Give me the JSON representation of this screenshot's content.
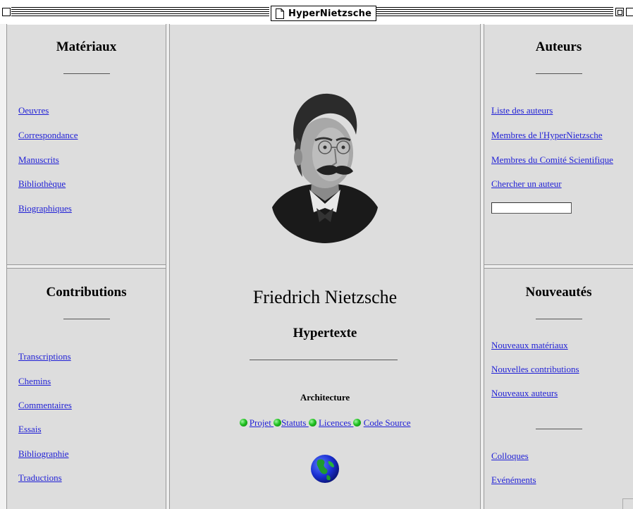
{
  "window": {
    "title": "HyperNietzsche"
  },
  "left_top": {
    "heading": "Matériaux",
    "links": [
      "Oeuvres",
      "Correspondance",
      "Manuscrits",
      "Bibliothèque",
      "Biographiques"
    ]
  },
  "left_bottom": {
    "heading": "Contributions",
    "links": [
      "Transcriptions",
      "Chemins",
      "Commentaires",
      "Essais",
      "Bibliographie",
      "Traductions"
    ]
  },
  "center": {
    "portrait": "portrait-of-nietzsche",
    "title": "Friedrich Nietzsche",
    "subtitle": "Hypertexte",
    "architecture_heading": "Architecture",
    "architecture_links": [
      "Projet ",
      "Statuts ",
      "Licences ",
      "Code Source"
    ],
    "globe": "globe-icon"
  },
  "right_top": {
    "heading": "Auteurs",
    "links": [
      "Liste des auteurs",
      "Membres de l'HyperNietzsche",
      "Membres du Comité Scientifique",
      "Chercher un auteur"
    ],
    "search_value": ""
  },
  "right_bottom": {
    "heading": "Nouveautés",
    "links_top": [
      "Nouveaux matériaux",
      "Nouvelles contributions",
      "Nouveaux auteurs"
    ],
    "links_bottom": [
      "Colloques",
      "Evénéments"
    ]
  },
  "colors": {
    "frame_bg": "#dddddd",
    "link": "#1f1fd6",
    "bullet": "#22c222"
  }
}
